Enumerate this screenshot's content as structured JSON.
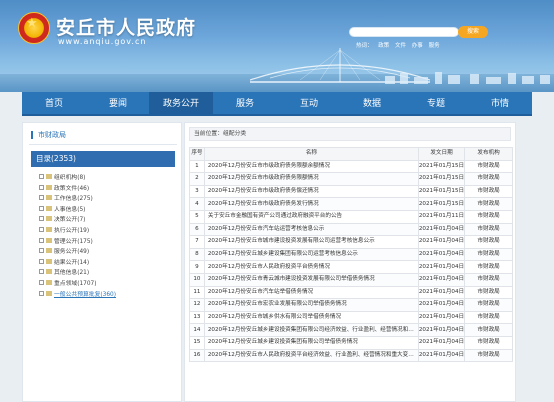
{
  "site": {
    "title": "安丘市人民政府",
    "url": "www.anqiu.gov.cn"
  },
  "search": {
    "placeholder": "",
    "button_label": "搜索"
  },
  "hot_words": [
    "热词：",
    "政策",
    "文件",
    "办事",
    "服务"
  ],
  "nav": [
    "首页",
    "要闻",
    "政务公开",
    "服务",
    "互动",
    "数据",
    "专题",
    "市情"
  ],
  "nav_active_index": 2,
  "sidebar": {
    "title": "市财政局",
    "directory": "目录(2353)",
    "items": [
      "组织机构(8)",
      "政策文件(46)",
      "工作信息(275)",
      "人事信息(5)",
      "决策公开(7)",
      "执行公开(19)",
      "管理公开(175)",
      "服务公开(49)",
      "结果公开(14)",
      "其他信息(21)",
      "重点领域(1707)",
      "一般公共预算批复(360)"
    ],
    "selected_index": 11
  },
  "breadcrumb": "当前位置：组配分类",
  "table": {
    "headers": [
      "序号",
      "名称",
      "发文日期",
      "发布机构"
    ],
    "rows": [
      [
        "1",
        "2020年12月份安丘市市级政府债务限额余额情况",
        "2021年01月15日",
        "市财政局"
      ],
      [
        "2",
        "2020年12月份安丘市市级政府债务限额情况",
        "2021年01月15日",
        "市财政局"
      ],
      [
        "3",
        "2020年12月份安丘市市级政府债务偿还情况",
        "2021年01月15日",
        "市财政局"
      ],
      [
        "4",
        "2020年12月份安丘市市级政府债务发行情况",
        "2021年01月15日",
        "市财政局"
      ],
      [
        "5",
        "关于安丘市金融国有资产公司通过政府融资平台的公告",
        "2021年01月11日",
        "市财政局"
      ],
      [
        "6",
        "2020年12月份安丘市汽车站运营考核信息公示",
        "2021年01月04日",
        "市财政局"
      ],
      [
        "7",
        "2020年12月份安丘市城市建设投资发展有限公司运营考核信息公示",
        "2021年01月04日",
        "市财政局"
      ],
      [
        "8",
        "2020年12月份安丘城乡建设集团有限公司运营考核信息公示",
        "2021年01月04日",
        "市财政局"
      ],
      [
        "9",
        "2020年12月份安丘市人民政府投资平台债务情况",
        "2021年01月04日",
        "市财政局"
      ],
      [
        "10",
        "2020年12月份安丘市青云城市建设投资发展有限公司举借债务情况",
        "2021年01月04日",
        "市财政局"
      ],
      [
        "11",
        "2020年12月份安丘市汽车站举借债务情况",
        "2021年01月04日",
        "市财政局"
      ],
      [
        "12",
        "2020年12月份安丘市宏农业发展有限公司举借债务情况",
        "2021年01月04日",
        "市财政局"
      ],
      [
        "13",
        "2020年12月份安丘市城乡供水有限公司举借债务情况",
        "2021年01月04日",
        "市财政局"
      ],
      [
        "14",
        "2020年12月份安丘城乡建设投资集团有限公司经济效益、行业盈利、经营情况和重...",
        "2021年01月04日",
        "市财政局"
      ],
      [
        "15",
        "2020年12月份安丘城乡建设投资集团有限公司举借债务情况",
        "2021年01月04日",
        "市财政局"
      ],
      [
        "16",
        "2020年12月份安丘市人民政府投资平台经济效益、行业盈利、经营情况和重大变化事...",
        "2021年01月04日",
        "市财政局"
      ]
    ]
  }
}
